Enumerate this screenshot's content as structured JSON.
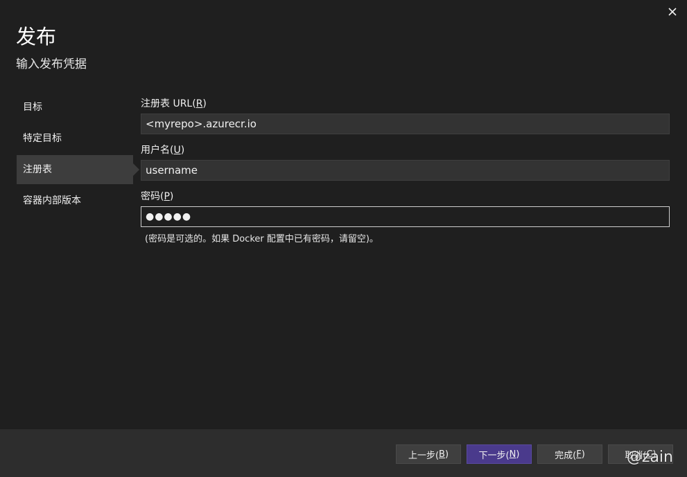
{
  "dialog": {
    "title": "发布",
    "subtitle": "输入发布凭据",
    "close_icon": "close-icon"
  },
  "nav": {
    "items": [
      {
        "label": "目标",
        "selected": false
      },
      {
        "label": "特定目标",
        "selected": false
      },
      {
        "label": "注册表",
        "selected": true
      },
      {
        "label": "容器内部版本",
        "selected": false
      }
    ]
  },
  "form": {
    "registry_url": {
      "label": "注册表 URL(",
      "mnemonic": "R",
      "label_end": ")",
      "value": "<myrepo>.azurecr.io"
    },
    "username": {
      "label": "用户名(",
      "mnemonic": "U",
      "label_end": ")",
      "value": "username"
    },
    "password": {
      "label": "密码(",
      "mnemonic": "P",
      "label_end": ")",
      "value": "●●●●●"
    },
    "hint": "(密码是可选的。如果 Docker 配置中已有密码，请留空)。"
  },
  "footer": {
    "back": {
      "label": "上一步(",
      "mnemonic": "B",
      "end": ")"
    },
    "next": {
      "label": "下一步(",
      "mnemonic": "N",
      "end": ")"
    },
    "finish": {
      "label": "完成(",
      "mnemonic": "F",
      "end": ")"
    },
    "cancel": {
      "label": "取消(",
      "mnemonic": "C",
      "end": ")"
    }
  },
  "watermark": "@zain",
  "colors": {
    "background": "#1f1f1f",
    "footer": "#2d2d2d",
    "selected_nav": "#3d3d3d",
    "primary_button": "#4a3a8c",
    "input_bg": "#333333"
  }
}
